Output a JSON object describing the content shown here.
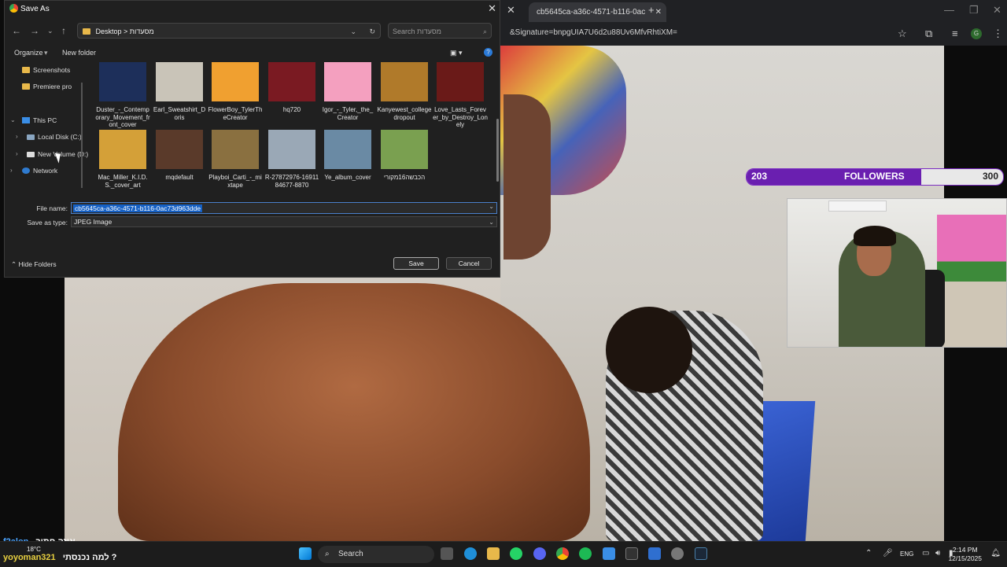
{
  "dialog": {
    "title": "Save As",
    "path": "Desktop  >  מסעדות",
    "search_placeholder": "Search מסעדות",
    "organize": "Organize",
    "new_folder": "New folder",
    "nav": {
      "screenshots": "Screenshots",
      "premiere": "Premiere pro",
      "this_pc": "This PC",
      "local_disk": "Local Disk (C:)",
      "new_volume": "New Volume (D:)",
      "network": "Network"
    },
    "files": [
      {
        "name": "Duster_-_Contemporary_Movement_front_cover",
        "color": "#1d2f5a"
      },
      {
        "name": "Earl_Sweatshirt_Doris",
        "color": "#c9c4b8"
      },
      {
        "name": "FlowerBoy_TylerTheCreator",
        "color": "#f0a030"
      },
      {
        "name": "hq720",
        "color": "#7a1a22"
      },
      {
        "name": "Igor_-_Tyler,_the_Creator",
        "color": "#f4a0bf"
      },
      {
        "name": "Kanyewest_collegedropout",
        "color": "#b07a2a"
      },
      {
        "name": "Love_Lasts_Forever_by_Destroy_Lonely",
        "color": "#6a1a18"
      },
      {
        "name": "Mac_Miller_K.I.D.S._cover_art",
        "color": "#d4a038"
      },
      {
        "name": "mqdefault",
        "color": "#5a3a2a"
      },
      {
        "name": "Playboi_Carti_-_mixtape",
        "color": "#8a7040"
      },
      {
        "name": "R-27872976-1691184677-8870",
        "color": "#9aa8b6"
      },
      {
        "name": "Ye_album_cover",
        "color": "#6a8aa4"
      },
      {
        "name": "הכבשה16מקורי",
        "color": "#7aa050"
      }
    ],
    "file_name_label": "File name:",
    "file_name_value": "cb5645ca-a36c-4571-b116-0ac73d963dde",
    "save_type_label": "Save as type:",
    "save_type_value": "JPEG Image",
    "hide_folders": "Hide Folders",
    "save": "Save",
    "cancel": "Cancel"
  },
  "browser": {
    "tab_title": "cb5645ca-a36c-4571-b116-0ac",
    "url": "&Signature=bnpgUIA7U6d2u88Uv6MfvRhtiXM=",
    "profile": "G"
  },
  "overlay": {
    "followers_current": "203",
    "followers_label": "FOLLOWERS",
    "followers_goal": "300",
    "followers_progress": 0.68
  },
  "chat": [
    {
      "user": "f2alon",
      "message": "איזה חתיך",
      "color": "#4aa3ff"
    },
    {
      "user": "yoyoman321",
      "message": "למה נכנסתי ?",
      "color": "#e8d040"
    }
  ],
  "taskbar": {
    "search": "Search",
    "weather": "18°C",
    "lang": "ENG",
    "time": "2:14 PM",
    "date": "12/15/2025"
  }
}
